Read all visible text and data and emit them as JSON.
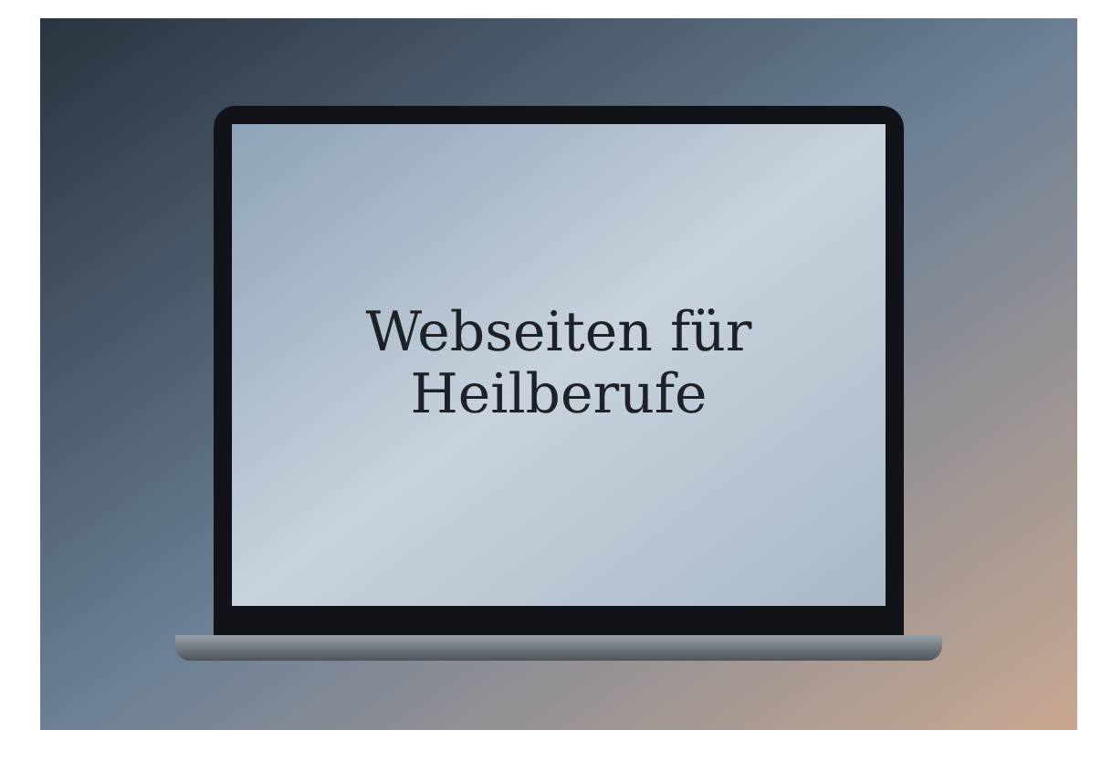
{
  "laptop_screen": {
    "title": "Webseiten für Heilberufe"
  }
}
